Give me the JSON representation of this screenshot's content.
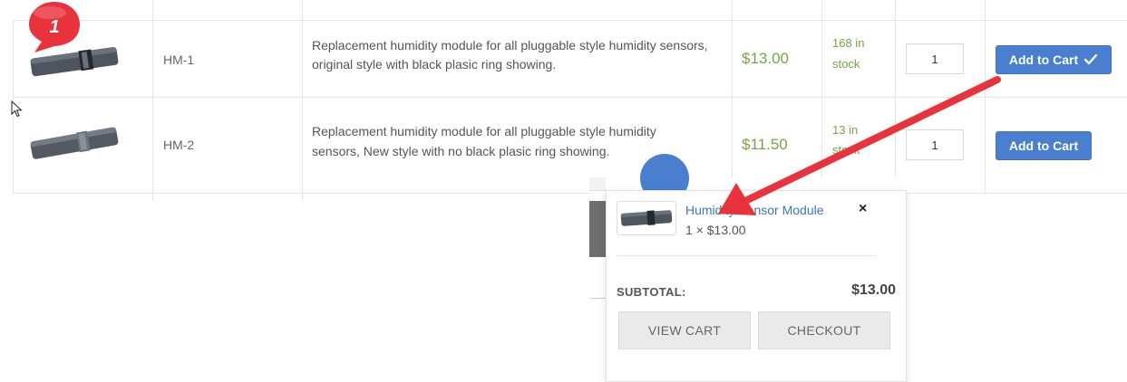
{
  "columns_note": "",
  "products": [
    {
      "sku": "HM-1",
      "description_line1": "Replacement humidity module for all pluggable style humidity sensors,",
      "description_line2": "original style with  black plasic ring showing.",
      "price": "$13.00",
      "stock_line1": "168 in",
      "stock_line2": "stock",
      "quantity": "1",
      "button_label": "Add to Cart",
      "button_state": "added"
    },
    {
      "sku": "HM-2",
      "description_line1": "Replacement humidity module for all pluggable style humidity",
      "description_line2": "sensors, New style with no black plasic ring showing.",
      "price": "$11.50",
      "stock_line1": "13 in",
      "stock_line2": "stock",
      "quantity": "1",
      "button_label": "Add to Cart",
      "button_state": "default"
    }
  ],
  "annotation": {
    "step_marker": "1",
    "marker_color": "#e8323c",
    "arrow_color": "#e8323c"
  },
  "mini_cart": {
    "item_title": "Humidity Sensor Module",
    "item_qty_price": "1 × $13.00",
    "close_symbol": "×",
    "subtotal_label": "SUBTOTAL:",
    "subtotal_value": "$13.00",
    "view_cart_label": "VIEW CART",
    "checkout_label": "CHECKOUT"
  },
  "colors": {
    "accent_blue": "#4a7fcf",
    "price_green": "#7aa24a",
    "link_blue": "#3d77b8"
  },
  "icons": {
    "check": "check-icon",
    "close": "close-icon",
    "cursor": "mouse-pointer-icon"
  }
}
